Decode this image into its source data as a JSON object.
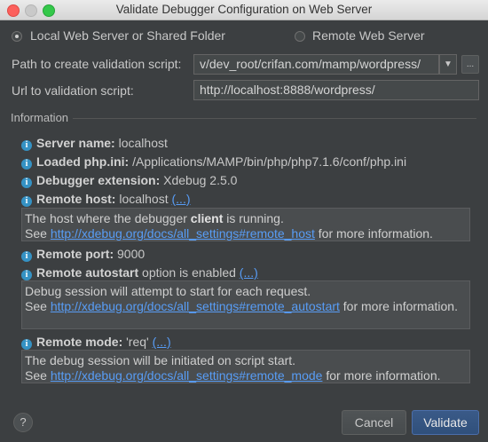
{
  "window": {
    "title": "Validate Debugger Configuration on Web Server"
  },
  "options": {
    "local_label": "Local Web Server or Shared Folder",
    "remote_label": "Remote Web Server",
    "selected": "local"
  },
  "path_field": {
    "label": "Path to create validation script:",
    "value": "v/dev_root/crifan.com/mamp/wordpress/",
    "more_label": "..."
  },
  "url_field": {
    "label": "Url to validation script:",
    "value": "http://localhost:8888/wordpress/"
  },
  "information": {
    "section_title": "Information",
    "server_name": {
      "label": "Server name:",
      "value": "localhost"
    },
    "loaded_ini": {
      "label": "Loaded php.ini:",
      "value": "/Applications/MAMP/bin/php/php7.1.6/conf/php.ini"
    },
    "debugger_ext": {
      "label": "Debugger extension:",
      "value": "Xdebug 2.5.0"
    },
    "remote_host": {
      "label": "Remote host:",
      "value": "localhost",
      "more": "(...)",
      "desc_pre": "The host where the debugger ",
      "desc_bold": "client",
      "desc_post": " is running.",
      "see": "See ",
      "link": "http://xdebug.org/docs/all_settings#remote_host",
      "suffix": " for more information."
    },
    "remote_port": {
      "label": "Remote port:",
      "value": "9000"
    },
    "remote_autostart": {
      "label": "Remote autostart",
      "value": "option is enabled",
      "more": "(...)",
      "desc": "Debug session will attempt to start for each request.",
      "see": "See ",
      "link": "http://xdebug.org/docs/all_settings#remote_autostart",
      "suffix": " for more information."
    },
    "remote_mode": {
      "label": "Remote mode:",
      "value": "'req'",
      "more": "(...)",
      "desc": "The debug session will be initiated on script start.",
      "see": "See ",
      "link": "http://xdebug.org/docs/all_settings#remote_mode",
      "suffix": " for more information."
    }
  },
  "buttons": {
    "help": "?",
    "cancel": "Cancel",
    "validate": "Validate"
  },
  "colors": {
    "background": "#3c3f41",
    "link": "#589df6",
    "primary_button": "#365880"
  }
}
